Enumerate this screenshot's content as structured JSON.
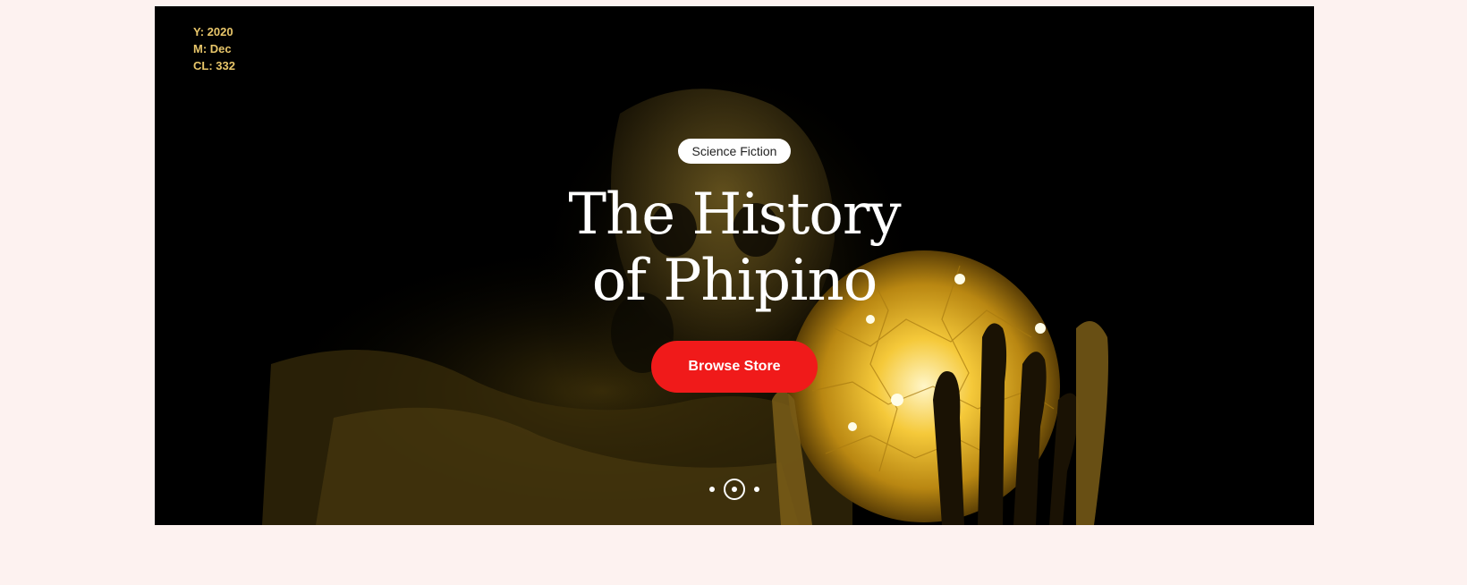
{
  "meta": {
    "year": "Y: 2020",
    "month": "M: Dec",
    "cl": "CL: 332"
  },
  "hero": {
    "category": "Science Fiction",
    "title_line1": "The History",
    "title_line2": "of Phipino",
    "cta_label": "Browse Store",
    "slides": {
      "count": 3,
      "active": 2
    }
  },
  "colors": {
    "page_bg": "#fdf2f0",
    "hero_bg": "#000000",
    "cta": "#f01a1a",
    "meta_text": "#e8c66a",
    "orb_glow": "#f5c93a"
  },
  "icons": {
    "orb": "glowing-crystal-ball-image",
    "pager": "slider-dots-icon"
  }
}
